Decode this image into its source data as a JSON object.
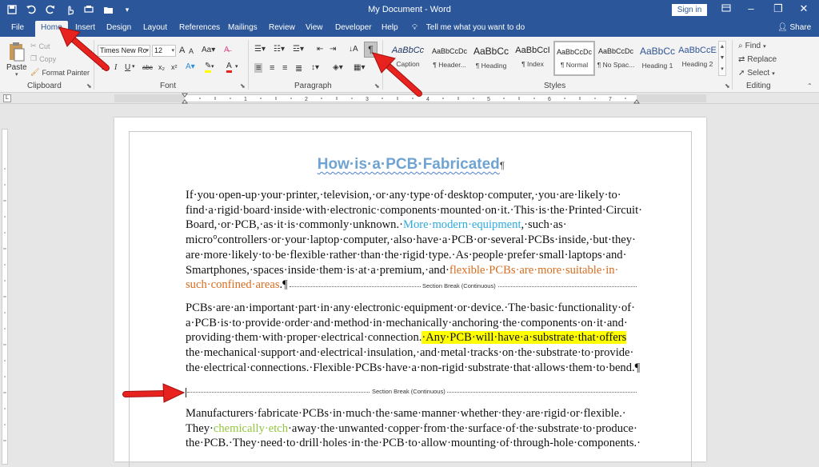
{
  "app": {
    "doc_title": "My Document - Word",
    "sign_in": "Sign in",
    "share": "Share",
    "tell_me": "Tell me what you want to do"
  },
  "tabs": [
    "File",
    "Home",
    "Insert",
    "Design",
    "Layout",
    "References",
    "Mailings",
    "Review",
    "View",
    "Developer",
    "Help"
  ],
  "clipboard": {
    "paste": "Paste",
    "cut": "Cut",
    "copy": "Copy",
    "format_painter": "Format Painter",
    "label": "Clipboard"
  },
  "font": {
    "name": "Times New Ro",
    "size": "12",
    "label": "Font",
    "bold": "B",
    "italic": "I",
    "underline": "U",
    "strike": "abc",
    "sub": "x₂",
    "sup": "x²",
    "grow": "A",
    "shrink": "A"
  },
  "paragraph": {
    "label": "Paragraph",
    "pilcrow": "¶"
  },
  "styles": {
    "label": "Styles",
    "items": [
      {
        "sample": "AaBbCc",
        "name": "Caption"
      },
      {
        "sample": "AaBbCcDc",
        "name": "¶ Header..."
      },
      {
        "sample": "AaBbCc",
        "name": "¶ Heading"
      },
      {
        "sample": "AaBbCcI",
        "name": "¶ Index"
      },
      {
        "sample": "AaBbCcDc",
        "name": "¶ Normal"
      },
      {
        "sample": "AaBbCcDc",
        "name": "¶ No Spac..."
      },
      {
        "sample": "AaBbCc",
        "name": "Heading 1"
      },
      {
        "sample": "AaBbCcE",
        "name": "Heading 2"
      }
    ]
  },
  "editing": {
    "find": "Find",
    "replace": "Replace",
    "select": "Select",
    "label": "Editing"
  },
  "document": {
    "heading": "How·is·a·PCB·Fabricated",
    "heading_mark": "¶",
    "p1": {
      "l1": "If·you·open-up·your·printer,·television,·or·any·type·of·desktop·computer,·you·are·likely·to·",
      "l2": "find·a·rigid·board·inside·with·electronic·components·mounted·on·it.·This·is·the·Printed·Circuit·",
      "l3a": "Board,·or·PCB,·as·it·is·commonly·unknown.·",
      "l3b": "More·modern·equipment",
      "l3c": ",·such·as·",
      "l4": "micro°controllers·or·your·laptop·computer,·also·have·a·PCB·or·several·PCBs·inside,·but·they·",
      "l5": "are·more·likely·to·be·flexible·rather·than·the·rigid·type.·As·people·prefer·small·laptops·and·",
      "l6a": "Smartphones,·spaces·inside·them·is·at·a·premium,·and·",
      "l6b": "flexible·PCBs·are·more·suitable·in·",
      "l7a": "such·confined·areas",
      "l7b": ".¶"
    },
    "section_break_1": "Section Break (Continuous)",
    "p2": {
      "l1": "PCBs·are·an·important·part·in·any·electronic·equipment·or·device.·The·basic·functionality·of·",
      "l2": "a·PCB·is·to·provide·order·and·method·in·mechanically·anchoring·the·components·on·it·and·",
      "l3a": "providing·them·with·proper·electrical·connection.",
      "l3b": "·Any·PCB·will·have·a·substrate·that·offers",
      "l4": "the·mechanical·support·and·electrical·insulation,·and·metal·tracks·on·the·substrate·to·provide·",
      "l5": "the·electrical·connections.·Flexible·PCBs·have·a·non-rigid·substrate·that·allows·them·to·bend.¶"
    },
    "section_break_2": "Section Break (Continuous)",
    "p3": {
      "l1": "Manufacturers·fabricate·PCBs·in·much·the·same·manner·whether·they·are·rigid·or·flexible.·",
      "l2a": "They·",
      "l2b": "chemically·etch",
      "l2c": "·away·the·unwanted·copper·from·the·surface·of·the·substrate·to·produce·",
      "l3": "the·PCB.·They·need·to·drill·holes·in·the·PCB·to·allow·mounting·of·through-hole·components.·"
    }
  },
  "colors": {
    "title_bar": "#2b579a",
    "heading": "#6fa3d2",
    "link_blue": "#2eaae1",
    "orange": "#d86c1d",
    "green": "#92c53f",
    "highlight": "#ffff00",
    "arrow_red": "#e8231f"
  }
}
